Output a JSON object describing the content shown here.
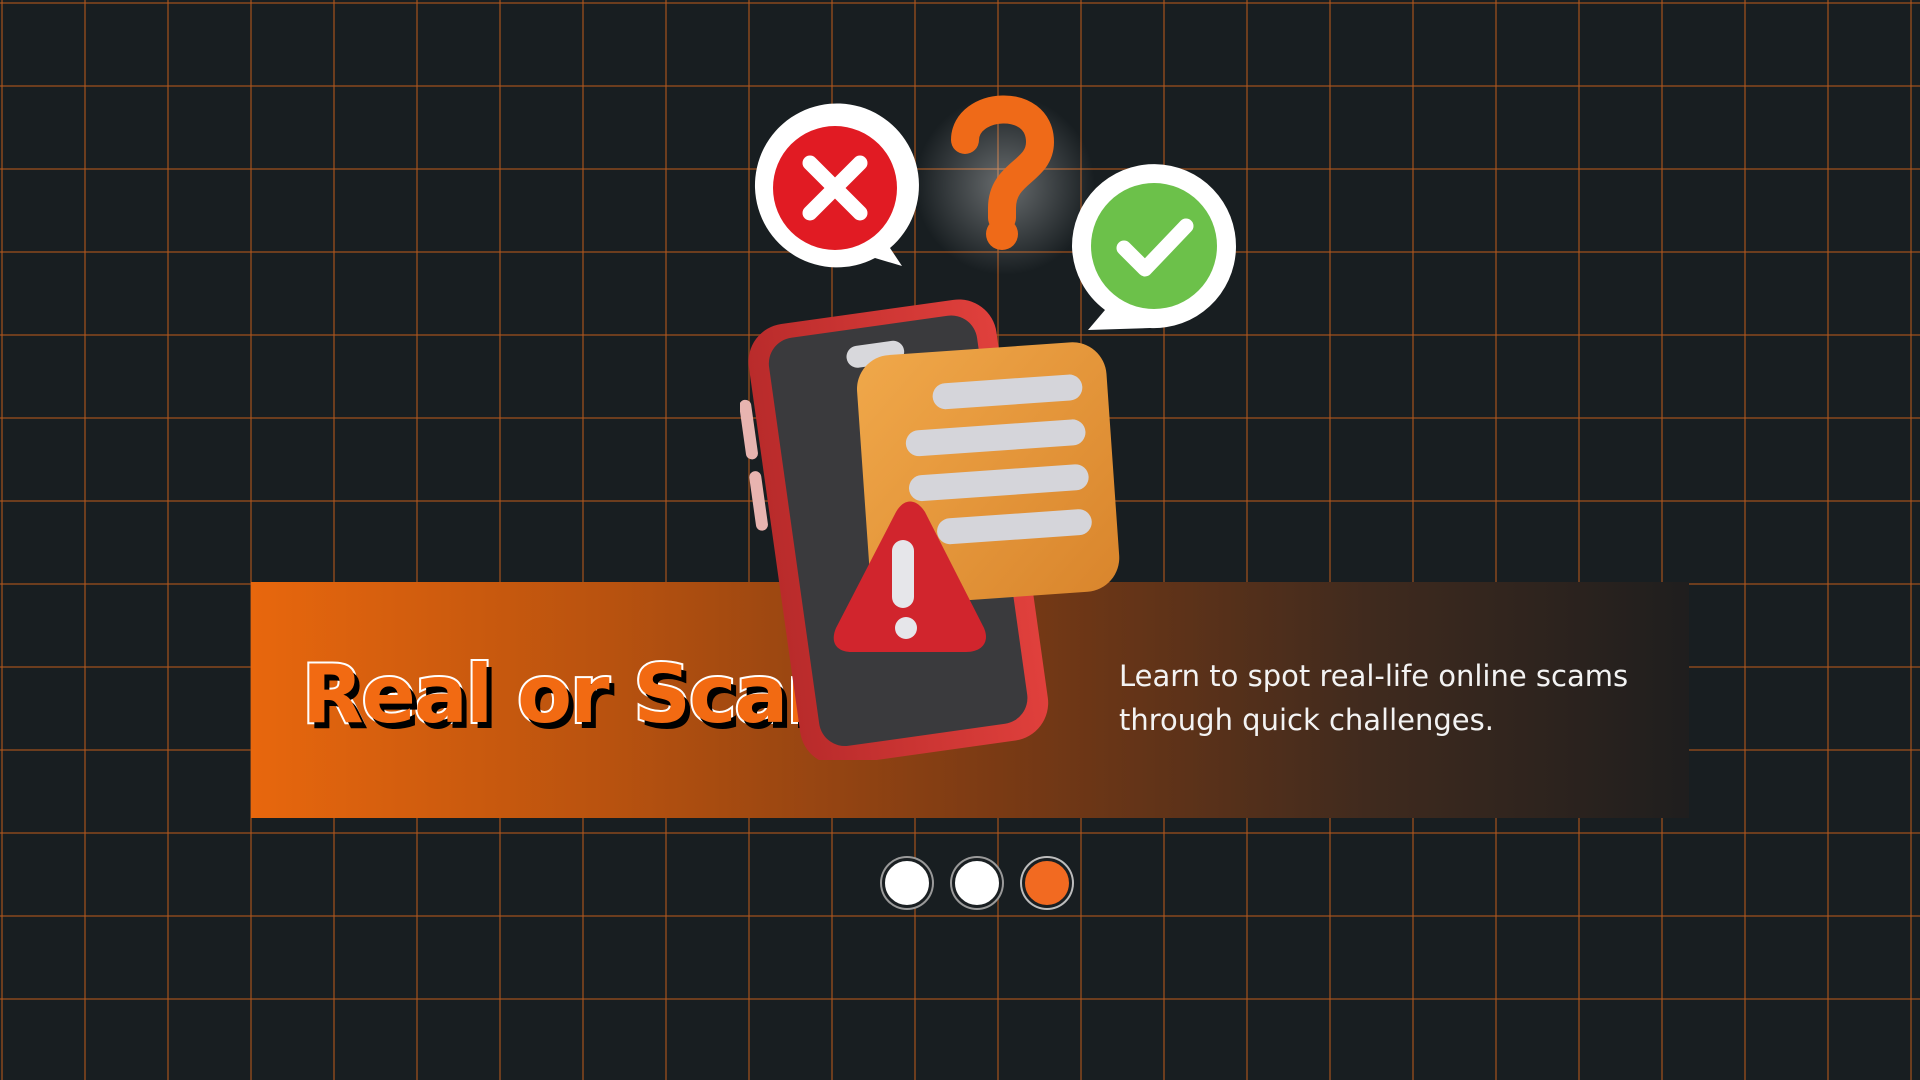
{
  "hero": {
    "title": "Real or Scam?",
    "description": "Learn to spot real-life online scams through quick challenges."
  },
  "illustration": {
    "icons": [
      "close-icon",
      "question-mark-icon",
      "check-icon",
      "smartphone-icon",
      "message-card-icon",
      "warning-icon"
    ]
  },
  "carousel": {
    "slide_count": 3,
    "active_index": 2
  },
  "colors": {
    "background": "#181e21",
    "grid_line": "#b0561c",
    "accent_orange": "#f26a12",
    "text_white": "#f3f3f3"
  }
}
